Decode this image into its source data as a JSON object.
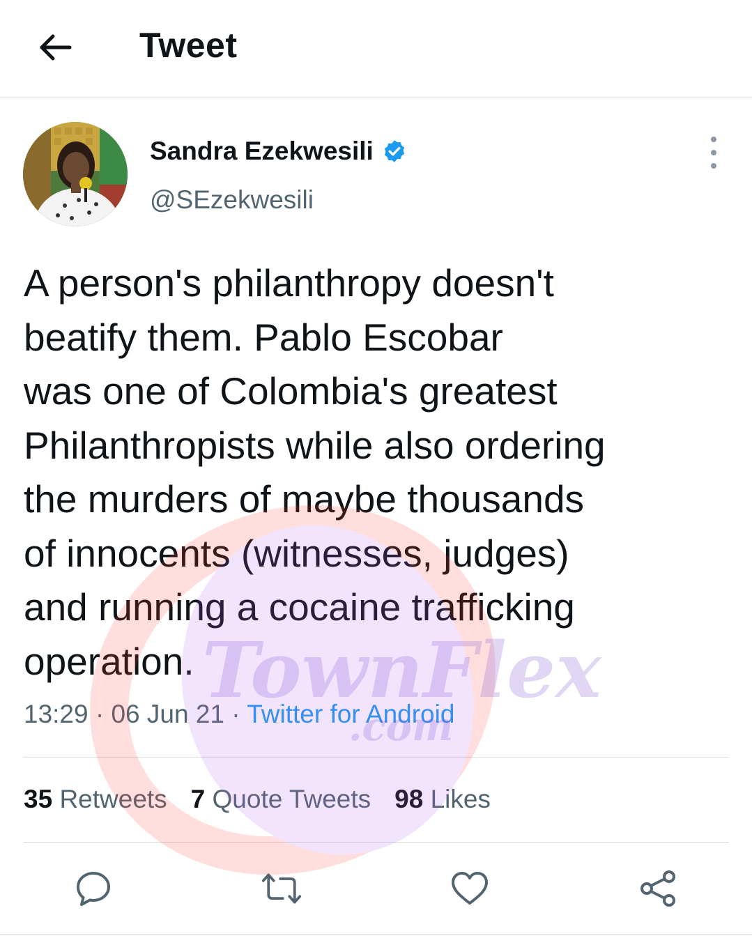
{
  "header": {
    "title": "Tweet",
    "back_icon": "arrow-left-icon"
  },
  "author": {
    "name": "Sandra Ezekwesili",
    "handle": "@SEzekwesili",
    "verified_icon": "verified-badge-icon",
    "more_icon": "more-vertical-icon"
  },
  "tweet": {
    "text": "A person's philanthropy doesn't\nbeatify them. Pablo Escobar\nwas one of Colombia's greatest\nPhilanthropists while also ordering\nthe murders of maybe thousands\nof innocents (witnesses, judges)\nand running a cocaine trafficking\noperation.",
    "time": "13:29",
    "separator": " · ",
    "date": "06 Jun 21",
    "source": "Twitter for Android"
  },
  "stats": {
    "retweets_count": "35",
    "retweets_label": "Retweets",
    "quotes_count": "7",
    "quotes_label": "Quote Tweets",
    "likes_count": "98",
    "likes_label": "Likes"
  },
  "actions": [
    "reply-icon",
    "retweet-icon",
    "like-icon",
    "share-icon"
  ],
  "watermark": {
    "line1": "TownFlex",
    "line2": ".com"
  },
  "colors": {
    "text": "#0f1419",
    "secondary": "#536471",
    "accent": "#1d9bf0",
    "divider": "#d7dbdf"
  }
}
